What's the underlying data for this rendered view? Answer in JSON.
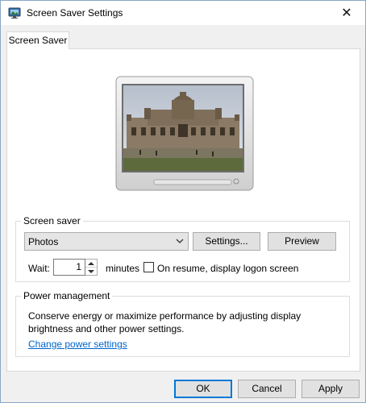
{
  "window": {
    "title": "Screen Saver Settings",
    "close_label": "✕"
  },
  "tabs": [
    {
      "label": "Screen Saver",
      "selected": true
    }
  ],
  "screen_saver": {
    "group_label": "Screen saver",
    "selected": "Photos",
    "settings_label": "Settings...",
    "preview_label": "Preview",
    "wait_label": "Wait:",
    "wait_value": "1",
    "minutes_label": "minutes",
    "resume_label": "On resume, display logon screen",
    "resume_checked": false
  },
  "power": {
    "group_label": "Power management",
    "description": "Conserve energy or maximize performance by adjusting display brightness and other power settings.",
    "link_label": "Change power settings"
  },
  "buttons": {
    "ok": "OK",
    "cancel": "Cancel",
    "apply": "Apply"
  },
  "colors": {
    "link": "#0066cc",
    "accent": "#0078d7"
  }
}
